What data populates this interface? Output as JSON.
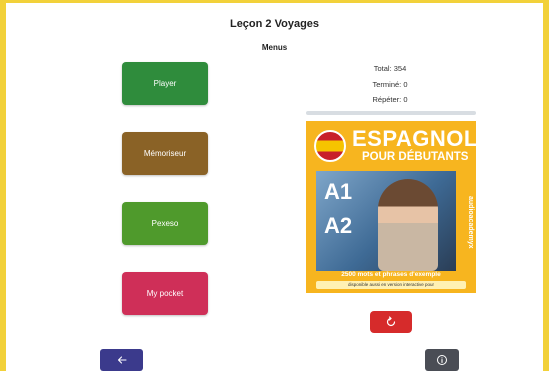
{
  "header": {
    "title": "Leçon 2 Voyages",
    "subtitle": "Menus"
  },
  "menu": {
    "player": "Player",
    "memoriseur": "Mémoriseur",
    "pexeso": "Pexeso",
    "my_pocket": "My pocket"
  },
  "stats": {
    "total": "Total: 354",
    "termine": "Terminé: 0",
    "repeter": "Répéter: 0",
    "progress_fraction": 0.0
  },
  "cover": {
    "title": "ESPAGNOL",
    "subtitle": "POUR DÉBUTANTS",
    "level_a1": "A1",
    "level_a2": "A2",
    "side_text": "audioacademyx",
    "tagline": "2500 mots et phrases d'exemple",
    "strip": "disponible aussi en version interactive pour"
  },
  "icons": {
    "reset": "refresh-icon",
    "back": "arrow-left-icon",
    "info": "info-icon"
  },
  "colors": {
    "frame": "#f2d13a",
    "player": "#2f8c3c",
    "memoriseur": "#8a6226",
    "pexeso": "#4f9a2c",
    "my_pocket": "#cf2f58",
    "reset": "#d62b2b",
    "back": "#3b3a8c",
    "info": "#4a4d55"
  }
}
